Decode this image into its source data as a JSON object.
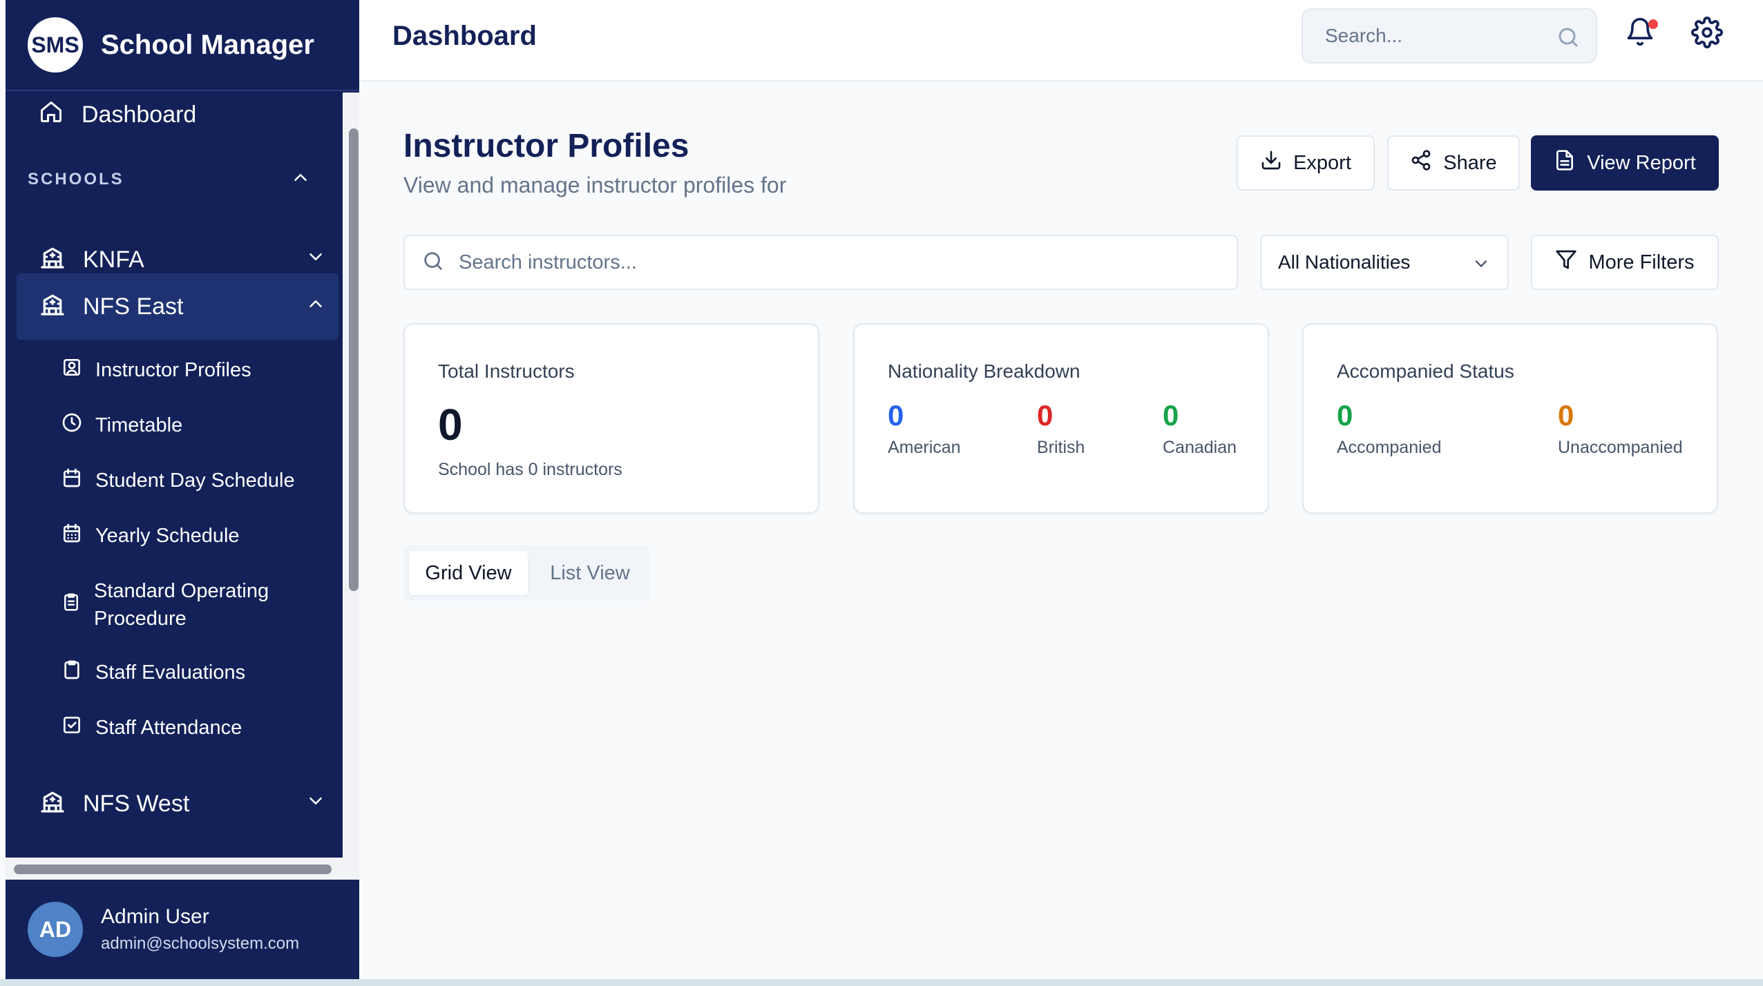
{
  "brand": {
    "logo": "SMS",
    "title": "School Manager"
  },
  "nav": {
    "dashboard": "Dashboard",
    "section_label": "SCHOOLS",
    "schools": [
      {
        "label": "KNFA",
        "expanded": false
      },
      {
        "label": "NFS East",
        "expanded": true
      },
      {
        "label": "NFS West",
        "expanded": false
      }
    ],
    "sub_items": [
      {
        "label": "Instructor Profiles",
        "icon": "user-square-icon"
      },
      {
        "label": "Timetable",
        "icon": "clock-icon"
      },
      {
        "label": "Student Day Schedule",
        "icon": "calendar-icon"
      },
      {
        "label": "Yearly Schedule",
        "icon": "calendar-grid-icon"
      },
      {
        "label": "Standard Operating Procedure",
        "icon": "clipboard-list-icon"
      },
      {
        "label": "Staff Evaluations",
        "icon": "clipboard-icon"
      },
      {
        "label": "Staff Attendance",
        "icon": "checkbox-icon"
      }
    ]
  },
  "user": {
    "initials": "AD",
    "name": "Admin User",
    "email": "admin@schoolsystem.com"
  },
  "header": {
    "title": "Dashboard",
    "search_placeholder": "Search...",
    "notification_unread": true
  },
  "page": {
    "title": "Instructor Profiles",
    "subtitle": "View and manage instructor profiles for",
    "actions": {
      "export": "Export",
      "share": "Share",
      "view_report": "View Report"
    }
  },
  "filters": {
    "search_placeholder": "Search instructors...",
    "nationality_selected": "All Nationalities",
    "more_filters": "More Filters"
  },
  "stats": {
    "total": {
      "title": "Total Instructors",
      "value": "0",
      "note": "School has 0 instructors"
    },
    "nationality": {
      "title": "Nationality Breakdown",
      "items": [
        {
          "value": "0",
          "label": "American",
          "color": "#2563eb"
        },
        {
          "value": "0",
          "label": "British",
          "color": "#dc2626"
        },
        {
          "value": "0",
          "label": "Canadian",
          "color": "#16a34a"
        }
      ]
    },
    "accompanied": {
      "title": "Accompanied Status",
      "items": [
        {
          "value": "0",
          "label": "Accompanied",
          "color": "#16a34a"
        },
        {
          "value": "0",
          "label": "Unaccompanied",
          "color": "#d97706"
        }
      ]
    }
  },
  "view_tabs": {
    "grid": "Grid View",
    "list": "List View",
    "active": "grid"
  },
  "colors": {
    "sidebar": "#132158",
    "accent": "#132158",
    "background": "#f8fafc"
  }
}
